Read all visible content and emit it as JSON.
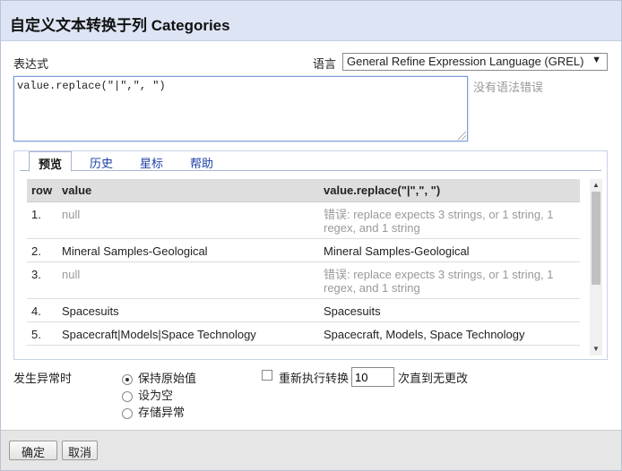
{
  "dialog": {
    "title": "自定义文本转换于列 Categories"
  },
  "expression": {
    "label": "表达式",
    "value": "value.replace(\"|\",\", \")",
    "status": "没有语法错误"
  },
  "language": {
    "label": "语言",
    "selected": "General Refine Expression Language (GREL)"
  },
  "tabs": [
    {
      "label": "预览",
      "active": true
    },
    {
      "label": "历史",
      "active": false
    },
    {
      "label": "星标",
      "active": false
    },
    {
      "label": "帮助",
      "active": false
    }
  ],
  "preview": {
    "columns": [
      "row",
      "value",
      "value.replace(\"|\",\", \")"
    ],
    "rows": [
      {
        "row": "1.",
        "value": "null",
        "result": "错误: replace expects 3 strings, or 1 string, 1 regex, and 1 string",
        "muted": true
      },
      {
        "row": "2.",
        "value": "Mineral Samples-Geological",
        "result": "Mineral Samples-Geological",
        "muted": false
      },
      {
        "row": "3.",
        "value": "null",
        "result": "错误: replace expects 3 strings, or 1 string, 1 regex, and 1 string",
        "muted": true
      },
      {
        "row": "4.",
        "value": "Spacesuits",
        "result": "Spacesuits",
        "muted": false
      },
      {
        "row": "5.",
        "value": "Spacecraft|Models|Space Technology",
        "result": "Spacecraft, Models, Space Technology",
        "muted": false
      }
    ]
  },
  "on_error": {
    "label": "发生异常时",
    "options": [
      {
        "label": "保持原始值",
        "checked": true
      },
      {
        "label": "设为空",
        "checked": false
      },
      {
        "label": "存储异常",
        "checked": false
      }
    ]
  },
  "reapply": {
    "checked": false,
    "label": "重新执行转换",
    "times": "10",
    "suffix": "次直到无更改"
  },
  "buttons": {
    "ok": "确定",
    "cancel": "取消"
  }
}
